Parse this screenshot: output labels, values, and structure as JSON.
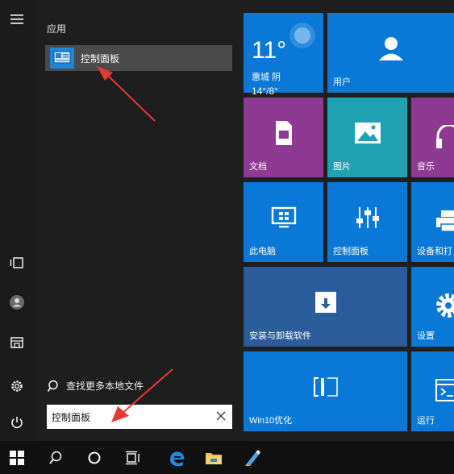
{
  "start_menu": {
    "section_label": "应用",
    "result": {
      "label": "控制面板",
      "icon": "control-panel-icon"
    },
    "search_more_label": "查找更多本地文件",
    "search_box_value": "控制面板"
  },
  "rail": {
    "icons": [
      "hamburger-menu-icon",
      "tablet-mode-icon",
      "user-icon",
      "documents-icon",
      "settings-icon",
      "power-icon"
    ]
  },
  "tiles": {
    "weather": {
      "temp": "11°",
      "city": "惠城  阴",
      "range": "14°/8°"
    },
    "user": {
      "label": "用户"
    },
    "documents": {
      "label": "文档"
    },
    "pictures": {
      "label": "图片"
    },
    "music": {
      "label": "音乐"
    },
    "this_pc": {
      "label": "此电脑"
    },
    "control_panel": {
      "label": "控制面板"
    },
    "devices": {
      "label": "设备和打"
    },
    "install": {
      "label": "安装与卸载软件"
    },
    "settings": {
      "label": "设置"
    },
    "win10": {
      "label": "Win10优化"
    },
    "run": {
      "label": "运行"
    }
  },
  "colors": {
    "tile_blue": "#0a78d7",
    "tile_purple": "#8e3a92",
    "tile_teal": "#1fa1b1",
    "tile_navy": "#2b5c9c",
    "arrow_red": "#e53935"
  }
}
